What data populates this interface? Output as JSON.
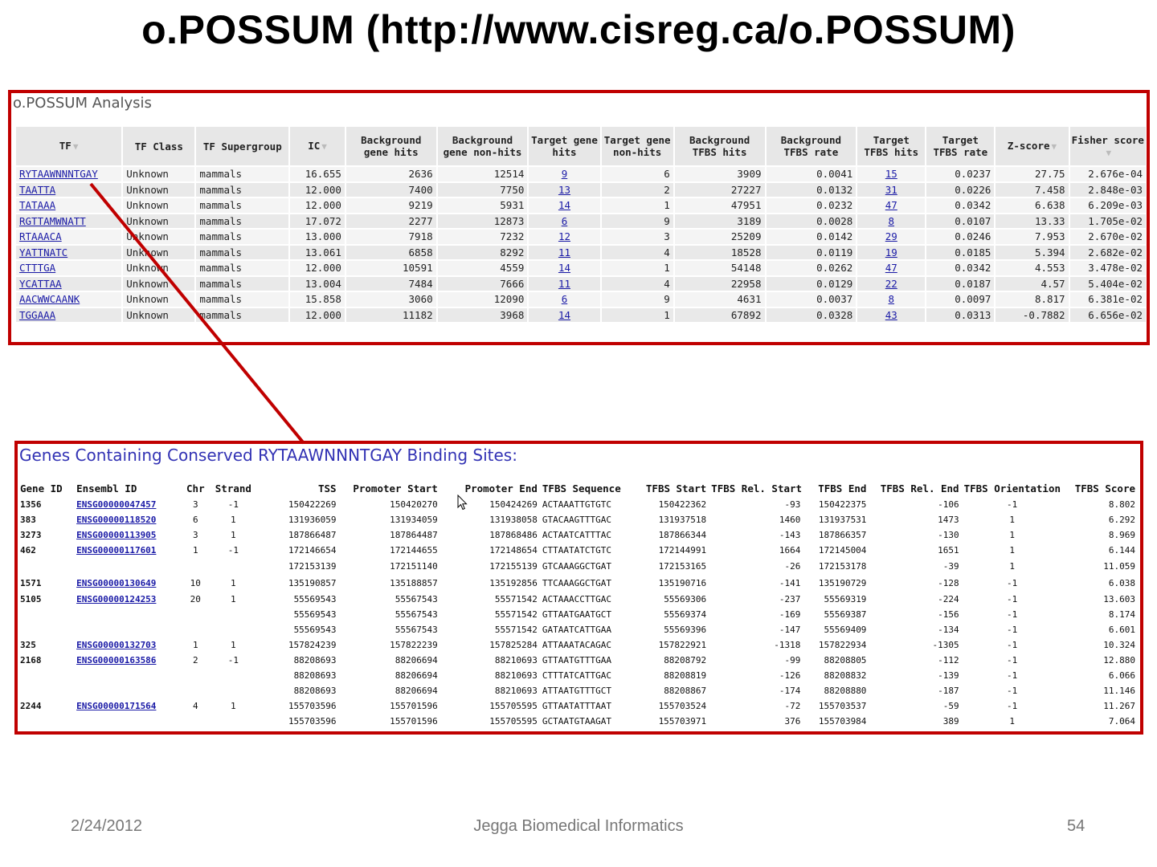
{
  "slide": {
    "title": "o.POSSUM (http://www.cisreg.ca/o.POSSUM)",
    "footer": {
      "date": "2/24/2012",
      "center": "Jegga Biomedical Informatics",
      "page": "54"
    }
  },
  "analysis": {
    "title": "o.POSSUM Analysis",
    "columns": [
      "TF",
      "TF Class",
      "TF Supergroup",
      "IC",
      "Background gene hits",
      "Background gene non-hits",
      "Target gene hits",
      "Target gene non-hits",
      "Background TFBS hits",
      "Background TFBS rate",
      "Target TFBS hits",
      "Target TFBS rate",
      "Z-score",
      "Fisher score"
    ],
    "rows": [
      [
        "RYTAAWNNNTGAY",
        "Unknown",
        "mammals",
        "16.655",
        "2636",
        "12514",
        "9",
        "6",
        "3909",
        "0.0041",
        "15",
        "0.0237",
        "27.75",
        "2.676e-04"
      ],
      [
        "TAATTA",
        "Unknown",
        "mammals",
        "12.000",
        "7400",
        "7750",
        "13",
        "2",
        "27227",
        "0.0132",
        "31",
        "0.0226",
        "7.458",
        "2.848e-03"
      ],
      [
        "TATAAA",
        "Unknown",
        "mammals",
        "12.000",
        "9219",
        "5931",
        "14",
        "1",
        "47951",
        "0.0232",
        "47",
        "0.0342",
        "6.638",
        "6.209e-03"
      ],
      [
        "RGTTAMWNATT",
        "Unknown",
        "mammals",
        "17.072",
        "2277",
        "12873",
        "6",
        "9",
        "3189",
        "0.0028",
        "8",
        "0.0107",
        "13.33",
        "1.705e-02"
      ],
      [
        "RTAAACA",
        "Unknown",
        "mammals",
        "13.000",
        "7918",
        "7232",
        "12",
        "3",
        "25209",
        "0.0142",
        "29",
        "0.0246",
        "7.953",
        "2.670e-02"
      ],
      [
        "YATTNATC",
        "Unknown",
        "mammals",
        "13.061",
        "6858",
        "8292",
        "11",
        "4",
        "18528",
        "0.0119",
        "19",
        "0.0185",
        "5.394",
        "2.682e-02"
      ],
      [
        "CTTTGA",
        "Unknown",
        "mammals",
        "12.000",
        "10591",
        "4559",
        "14",
        "1",
        "54148",
        "0.0262",
        "47",
        "0.0342",
        "4.553",
        "3.478e-02"
      ],
      [
        "YCATTAA",
        "Unknown",
        "mammals",
        "13.004",
        "7484",
        "7666",
        "11",
        "4",
        "22958",
        "0.0129",
        "22",
        "0.0187",
        "4.57",
        "5.404e-02"
      ],
      [
        "AACWWCAANK",
        "Unknown",
        "mammals",
        "15.858",
        "3060",
        "12090",
        "6",
        "9",
        "4631",
        "0.0037",
        "8",
        "0.0097",
        "8.817",
        "6.381e-02"
      ],
      [
        "TGGAAA",
        "Unknown",
        "mammals",
        "12.000",
        "11182",
        "3968",
        "14",
        "1",
        "67892",
        "0.0328",
        "43",
        "0.0313",
        "-0.7882",
        "6.656e-02"
      ]
    ]
  },
  "genes": {
    "title": "Genes Containing Conserved RYTAAWNNNTGAY Binding Sites:",
    "columns": [
      "Gene ID",
      "Ensembl ID",
      "Chr",
      "Strand",
      "TSS",
      "Promoter Start",
      "Promoter End",
      "TFBS Sequence",
      "TFBS Start",
      "TFBS Rel. Start",
      "TFBS End",
      "TFBS Rel. End",
      "TFBS Orientation",
      "TFBS Score"
    ],
    "rows": [
      [
        "1356",
        "ENSG00000047457",
        "3",
        "-1",
        "150422269",
        "150420270",
        "150424269",
        "ACTAAATTGTGTC",
        "150422362",
        "-93",
        "150422375",
        "-106",
        "-1",
        "8.802"
      ],
      [
        "383",
        "ENSG00000118520",
        "6",
        "1",
        "131936059",
        "131934059",
        "131938058",
        "GTACAAGTTTGAC",
        "131937518",
        "1460",
        "131937531",
        "1473",
        "1",
        "6.292"
      ],
      [
        "3273",
        "ENSG00000113905",
        "3",
        "1",
        "187866487",
        "187864487",
        "187868486",
        "ACTAATCATTTAC",
        "187866344",
        "-143",
        "187866357",
        "-130",
        "1",
        "8.969"
      ],
      [
        "462",
        "ENSG00000117601",
        "1",
        "-1",
        "172146654",
        "172144655",
        "172148654",
        "CTTAATATCTGTC",
        "172144991",
        "1664",
        "172145004",
        "1651",
        "1",
        "6.144"
      ],
      [
        "",
        "",
        "",
        "",
        "172153139",
        "172151140",
        "172155139",
        "GTCAAAGGCTGAT",
        "172153165",
        "-26",
        "172153178",
        "-39",
        "1",
        "11.059"
      ],
      [
        "1571",
        "ENSG00000130649",
        "10",
        "1",
        "135190857",
        "135188857",
        "135192856",
        "TTCAAAGGCTGAT",
        "135190716",
        "-141",
        "135190729",
        "-128",
        "-1",
        "6.038"
      ],
      [
        "5105",
        "ENSG00000124253",
        "20",
        "1",
        "55569543",
        "55567543",
        "55571542",
        "ACTAAACCTTGAC",
        "55569306",
        "-237",
        "55569319",
        "-224",
        "-1",
        "13.603"
      ],
      [
        "",
        "",
        "",
        "",
        "55569543",
        "55567543",
        "55571542",
        "GTTAATGAATGCT",
        "55569374",
        "-169",
        "55569387",
        "-156",
        "-1",
        "8.174"
      ],
      [
        "",
        "",
        "",
        "",
        "55569543",
        "55567543",
        "55571542",
        "GATAATCATTGAA",
        "55569396",
        "-147",
        "55569409",
        "-134",
        "-1",
        "6.601"
      ],
      [
        "325",
        "ENSG00000132703",
        "1",
        "1",
        "157824239",
        "157822239",
        "157825284",
        "ATTAAATACAGAC",
        "157822921",
        "-1318",
        "157822934",
        "-1305",
        "-1",
        "10.324"
      ],
      [
        "2168",
        "ENSG00000163586",
        "2",
        "-1",
        "88208693",
        "88206694",
        "88210693",
        "GTTAATGTTTGAA",
        "88208792",
        "-99",
        "88208805",
        "-112",
        "-1",
        "12.880"
      ],
      [
        "",
        "",
        "",
        "",
        "88208693",
        "88206694",
        "88210693",
        "CTTTATCATTGAC",
        "88208819",
        "-126",
        "88208832",
        "-139",
        "-1",
        "6.066"
      ],
      [
        "",
        "",
        "",
        "",
        "88208693",
        "88206694",
        "88210693",
        "ATTAATGTTTGCT",
        "88208867",
        "-174",
        "88208880",
        "-187",
        "-1",
        "11.146"
      ],
      [
        "2244",
        "ENSG00000171564",
        "4",
        "1",
        "155703596",
        "155701596",
        "155705595",
        "GTTAATATTTAAT",
        "155703524",
        "-72",
        "155703537",
        "-59",
        "-1",
        "11.267"
      ],
      [
        "",
        "",
        "",
        "",
        "155703596",
        "155701596",
        "155705595",
        "GCTAATGTAAGAT",
        "155703971",
        "376",
        "155703984",
        "389",
        "1",
        "7.064"
      ]
    ]
  },
  "icons": {
    "sort": "sort-arrow-icon",
    "cursor": "mouse-cursor-icon"
  },
  "colors": {
    "frame": "#c00000",
    "link": "#1a1aa6",
    "genes_title": "#3232b4"
  }
}
